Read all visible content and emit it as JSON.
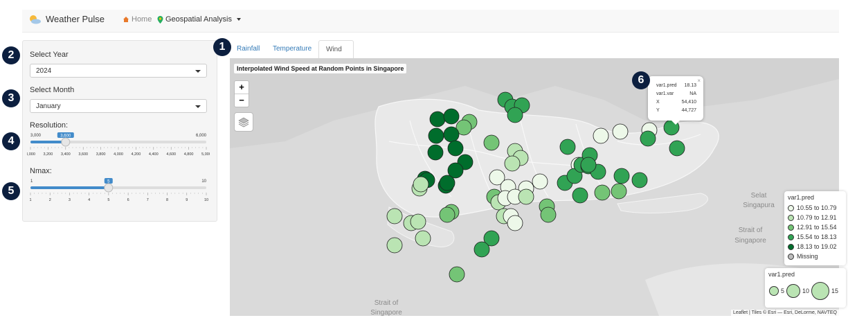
{
  "navbar": {
    "brand": "Weather Pulse",
    "home": "Home",
    "geospatial": "Geospatial Analysis"
  },
  "sidebar": {
    "year_label": "Select Year",
    "year_value": "2024",
    "month_label": "Select Month",
    "month_value": "January",
    "resolution_label": "Resolution:",
    "resolution_min": "3,000",
    "resolution_max": "6,000",
    "resolution_value": "3,600",
    "resolution_fraction": 0.2,
    "resolution_ticks": [
      "3,000",
      "3,200",
      "3,400",
      "3,600",
      "3,800",
      "4,000",
      "4,200",
      "4,400",
      "4,600",
      "4,800",
      "5,000"
    ],
    "nmax_label": "Nmax:",
    "nmax_min": "1",
    "nmax_max": "10",
    "nmax_value": "5",
    "nmax_fraction": 0.444,
    "nmax_ticks": [
      "1",
      "2",
      "3",
      "4",
      "5",
      "6",
      "7",
      "8",
      "9",
      "10"
    ]
  },
  "badges": [
    "1",
    "2",
    "3",
    "4",
    "5",
    "6"
  ],
  "tabs": [
    {
      "label": "Rainfall"
    },
    {
      "label": "Temperature"
    },
    {
      "label": "Wind Speed"
    }
  ],
  "map": {
    "title": "Interpolated Wind Speed at Random Points in Singapore",
    "zoom_in": "+",
    "zoom_out": "−",
    "place_labels": [
      "Selat",
      "Singapura",
      "Strait of",
      "Singapore",
      "Strait of",
      "Singapore"
    ],
    "attribution": "Leaflet | Tiles © Esri — Esri, DeLorme, NAVTEQ"
  },
  "popup": {
    "close": "×",
    "rows": [
      [
        "var1.pred",
        "18.13"
      ],
      [
        "var1.var",
        "NA"
      ],
      [
        "X",
        "54,410"
      ],
      [
        "Y",
        "44,727"
      ]
    ]
  },
  "legend_color": {
    "title": "var1.pred",
    "items": [
      {
        "label": "10.55 to 10.79",
        "color": "#edf8e9"
      },
      {
        "label": "10.79 to 12.91",
        "color": "#bae4b3"
      },
      {
        "label": "12.91 to 15.54",
        "color": "#74c476"
      },
      {
        "label": "15.54 to 18.13",
        "color": "#31a354"
      },
      {
        "label": "18.13 to 19.02",
        "color": "#006d2c"
      },
      {
        "label": "Missing",
        "color": "#bdbdbd"
      }
    ]
  },
  "legend_size": {
    "title": "var1.pred",
    "labels": [
      "5",
      "10",
      "15"
    ]
  }
}
